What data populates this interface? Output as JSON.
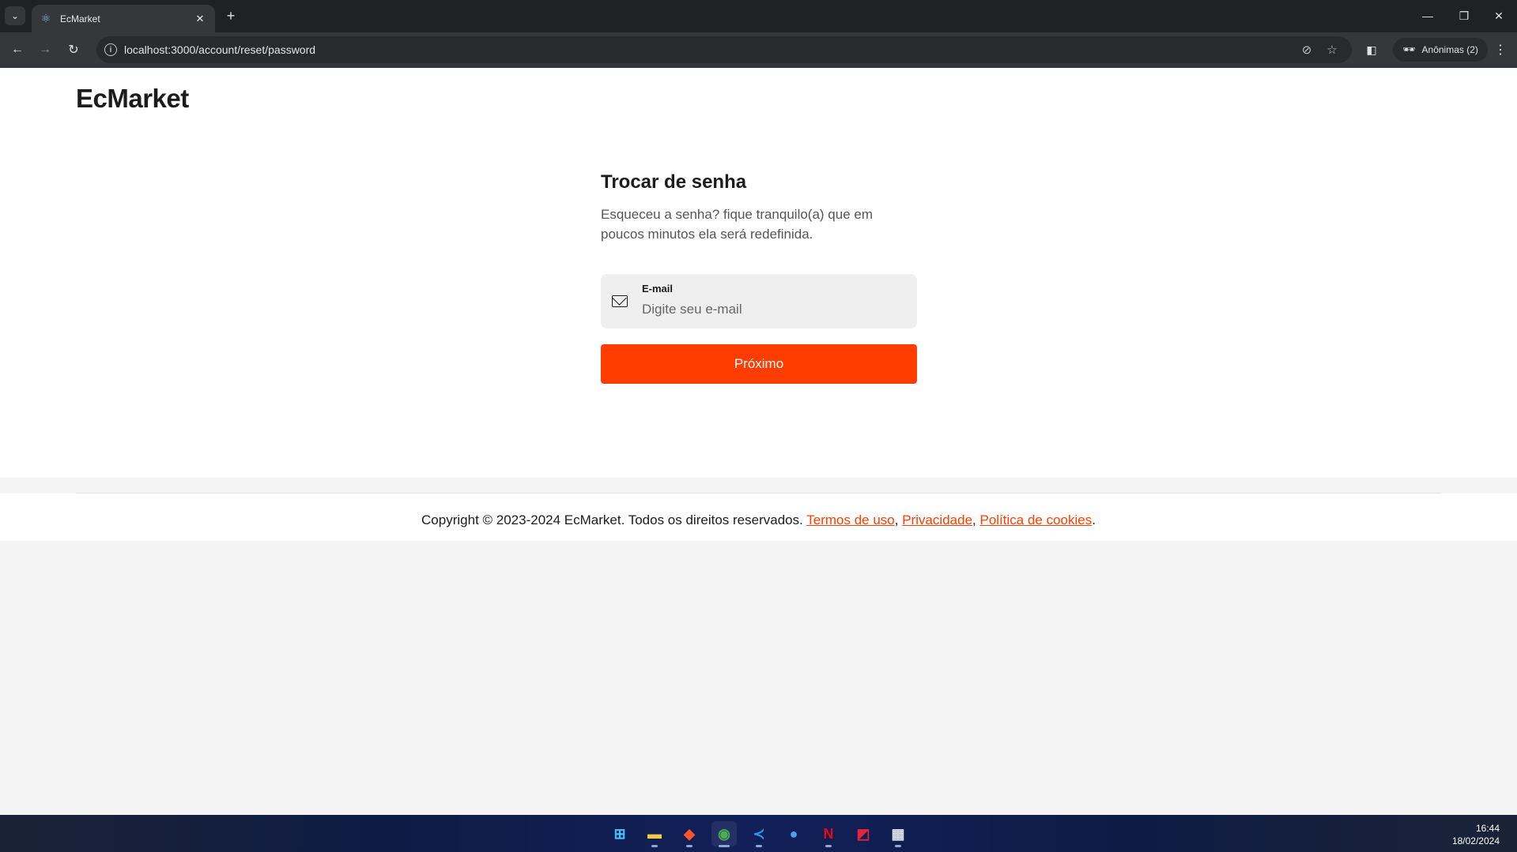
{
  "browser": {
    "tab_title": "EcMarket",
    "url": "localhost:3000/account/reset/password",
    "incognito_label": "Anônimas (2)"
  },
  "site": {
    "brand": "EcMarket"
  },
  "form": {
    "title": "Trocar de senha",
    "description": "Esqueceu a senha? fique tranquilo(a) que em poucos minutos ela será redefinida.",
    "email_label": "E-mail",
    "email_placeholder": "Digite seu e-mail",
    "email_value": "",
    "submit_label": "Próximo"
  },
  "footer": {
    "text": "Copyright © 2023-2024 EcMarket. Todos os direitos reservados.",
    "links": [
      "Termos de uso",
      "Privacidade",
      "Política de cookies"
    ]
  },
  "taskbar": {
    "time": "16:44",
    "date": "18/02/2024"
  },
  "colors": {
    "accent": "#ff3d00",
    "text": "#1c1c1c",
    "field_bg": "#efefef"
  }
}
